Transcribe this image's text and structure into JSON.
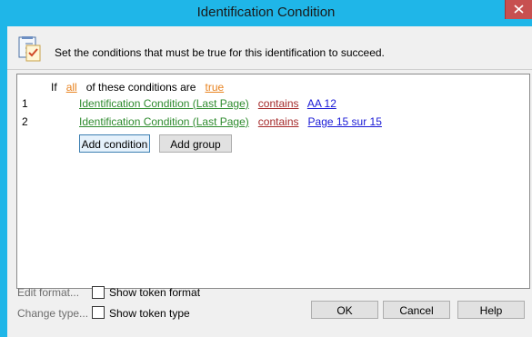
{
  "window": {
    "title": "Identification Condition"
  },
  "header": {
    "text": "Set the conditions that must be true for this identification to succeed."
  },
  "conditions": {
    "prefix": "If",
    "quantifier": "all",
    "middle": "of these conditions are",
    "truth": "true",
    "rows": [
      {
        "num": "1",
        "field": "Identification Condition (Last Page)",
        "op": "contains",
        "value": "AA 12"
      },
      {
        "num": "2",
        "field": "Identification Condition (Last Page)",
        "op": "contains",
        "value": "Page 15 sur 15"
      }
    ],
    "add_condition_label": "Add condition",
    "add_group_label": "Add group"
  },
  "footer": {
    "edit_format": "Edit format...",
    "change_type": "Change type...",
    "show_token_format": "Show token format",
    "show_token_type": "Show token type",
    "ok": "OK",
    "cancel": "Cancel",
    "help": "Help"
  },
  "colors": {
    "title_bar": "#1fb6e8",
    "field_link": "#2e8b2e",
    "operator_link": "#a52a2a",
    "keyword_link": "#e8821e",
    "value_link": "#1a1ad6"
  }
}
